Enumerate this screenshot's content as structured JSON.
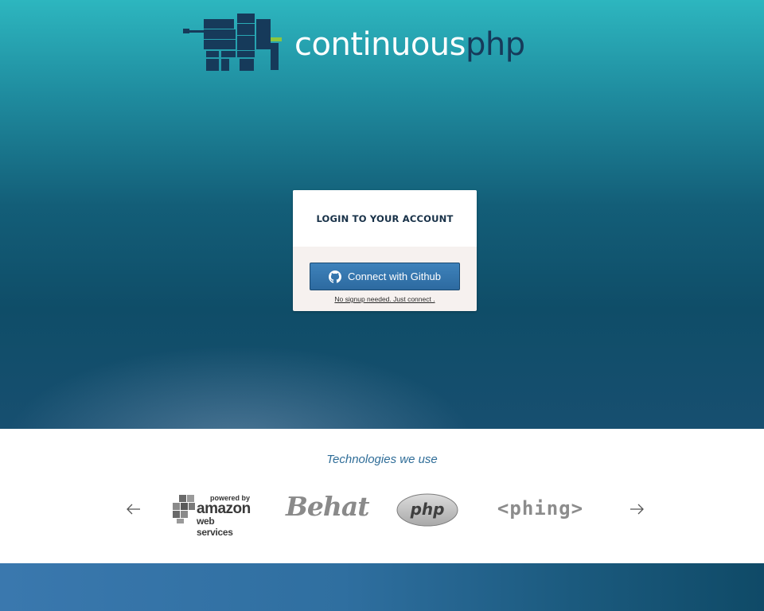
{
  "brand": {
    "name_part1": "continuous",
    "name_part2": "php",
    "colors": {
      "light": "#ffffff",
      "dark": "#163a5a",
      "accent": "#8dc63f"
    }
  },
  "login": {
    "title": "LOGIN TO YOUR ACCOUNT",
    "github_button_label": "Connect with Github",
    "github_icon": "github-icon",
    "note": "No signup needed. Just connect ."
  },
  "technologies": {
    "title": "Technologies we use",
    "prev_icon": "arrow-left-icon",
    "next_icon": "arrow-right-icon",
    "logos": {
      "aws": {
        "powered_by": "powered by",
        "brand": "amazon",
        "sub": "web services"
      },
      "behat": "Behat",
      "php": "php",
      "phing": "<phing>"
    }
  },
  "colors": {
    "hero_top": "#2db6bf",
    "hero_bottom": "#0f4d68",
    "button": "#3175ad",
    "accent_text": "#2f6d98"
  }
}
